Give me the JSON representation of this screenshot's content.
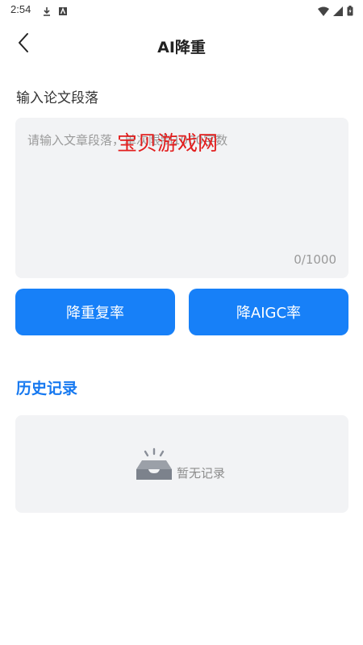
{
  "status_bar": {
    "time": "2:54",
    "left_icons": [
      "download-icon",
      "app-notification-icon"
    ],
    "right_icons": [
      "wifi-icon",
      "signal-icon",
      "battery-charging-icon"
    ]
  },
  "nav": {
    "back_icon": "chevron-left-icon",
    "title": "AI降重"
  },
  "input_section": {
    "label": "输入论文段落",
    "placeholder": "请输入文章段落，单次限制1000字数",
    "value": "",
    "char_count": "0/1000"
  },
  "watermark": "宝贝游戏网",
  "actions": {
    "reduce_repeat_label": "降重复率",
    "reduce_aigc_label": "降AIGC率"
  },
  "history": {
    "title": "历史记录",
    "empty_icon": "empty-inbox-icon",
    "empty_text": "暂无记录"
  },
  "colors": {
    "accent": "#1780f8",
    "history_title": "#1779f0",
    "panel_bg": "#f2f3f5",
    "watermark": "#e21d1d"
  }
}
